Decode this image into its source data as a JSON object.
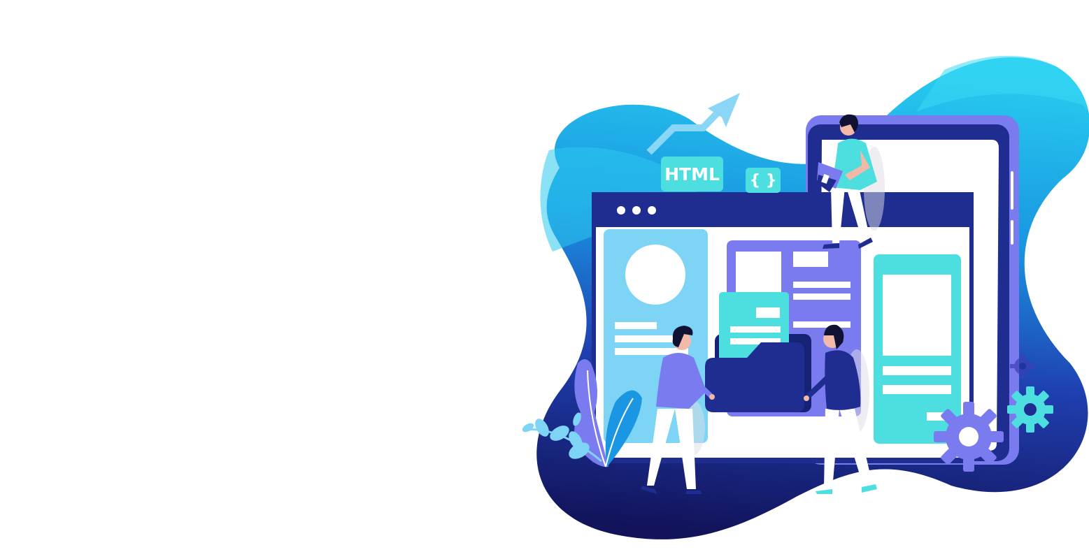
{
  "illustration": {
    "html_tag": "HTML",
    "braces_tag": "{ }",
    "colors": {
      "blob_light": "#27cdef",
      "blob_mid": "#1c8fe0",
      "blob_dark": "#13165a",
      "browser_navy": "#1e2d8f",
      "purple": "#7a7bef",
      "light_blue": "#7dd4f5",
      "teal": "#4ddfe0",
      "white": "#ffffff"
    }
  }
}
